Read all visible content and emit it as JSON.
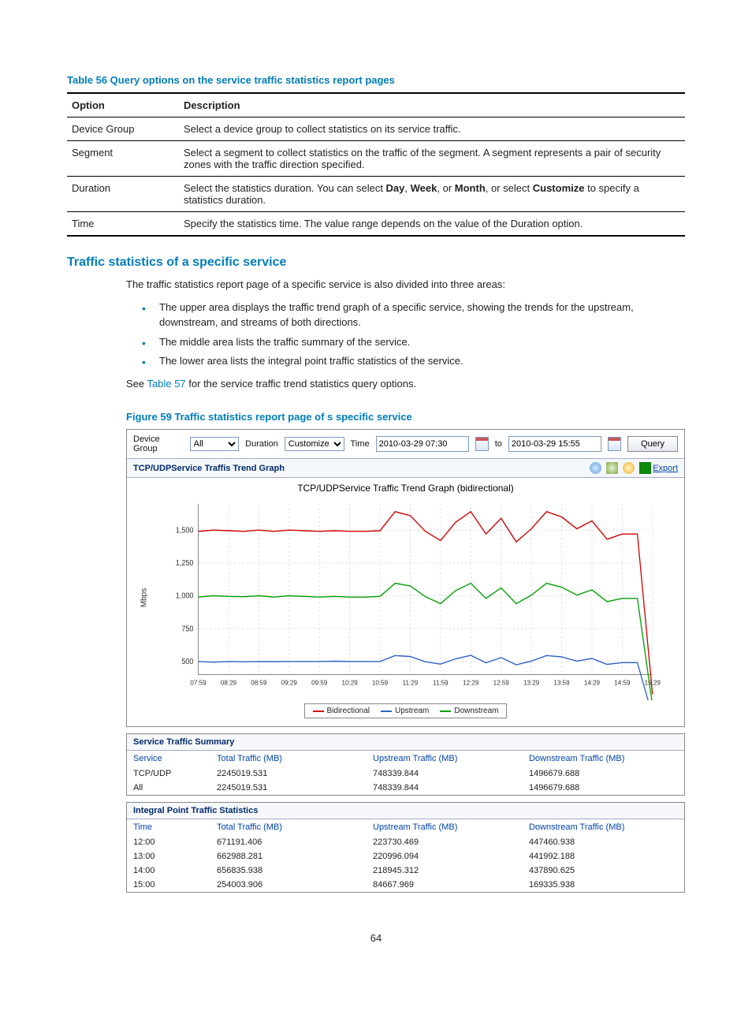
{
  "table56": {
    "title": "Table 56 Query options on the service traffic statistics report pages",
    "headers": {
      "option": "Option",
      "desc": "Description"
    },
    "rows": [
      {
        "option": "Device Group",
        "desc": "Select a device group to collect statistics on its service traffic."
      },
      {
        "option": "Segment",
        "desc": "Select a segment to collect statistics on the traffic of the segment. A segment represents a pair of security zones with the traffic direction specified."
      },
      {
        "option": "Duration",
        "desc_parts": [
          "Select the statistics duration. You can select ",
          "Day",
          ", ",
          "Week",
          ", or ",
          "Month",
          ", or select ",
          "Customize",
          " to specify a statistics duration."
        ]
      },
      {
        "option": "Time",
        "desc": "Specify the statistics time. The value range depends on the value of the Duration option."
      }
    ]
  },
  "section": {
    "heading": "Traffic statistics of a specific service",
    "intro": "The traffic statistics report page of a specific service is also divided into three areas:",
    "bullets": [
      "The upper area displays the traffic trend graph of a specific service, showing the trends for the upstream, downstream, and streams of both directions.",
      "The middle area lists the traffic summary of the service.",
      "The lower area lists the integral point traffic statistics of the service."
    ],
    "see_prefix": "See ",
    "see_link": "Table 57",
    "see_suffix": " for the service traffic trend statistics query options."
  },
  "figure": {
    "title": "Figure 59 Traffic statistics report page of s specific service",
    "filter": {
      "device_group_label": "Device Group",
      "device_group_value": "All",
      "duration_label": "Duration",
      "duration_value": "Customize",
      "time_label": "Time",
      "time_from": "2010-03-29 07:30",
      "time_to_label": "to",
      "time_to": "2010-03-29 15:55",
      "query_btn": "Query"
    },
    "graph": {
      "panel_title": "TCP/UDPService Traffis Trend Graph",
      "chart_title": "TCP/UDPService Traffic Trend Graph (bidirectional)",
      "ylabel": "Mbps",
      "export_label": "Export",
      "legend": {
        "bidir": "Bidirectional",
        "up": "Upstream",
        "down": "Downstream"
      }
    },
    "summary": {
      "title": "Service Traffic Summary",
      "headers": {
        "service": "Service",
        "total": "Total Traffic (MB)",
        "up": "Upstream Traffic (MB)",
        "down": "Downstream Traffic (MB)"
      },
      "rows": [
        {
          "service": "TCP/UDP",
          "total": "2245019.531",
          "up": "748339.844",
          "down": "1496679.688"
        },
        {
          "service": "All",
          "total": "2245019.531",
          "up": "748339.844",
          "down": "1496679.688"
        }
      ]
    },
    "integral": {
      "title": "Integral Point Traffic Statistics",
      "headers": {
        "time": "Time",
        "total": "Total Traffic (MB)",
        "up": "Upstream Traffic (MB)",
        "down": "Downstream Traffic (MB)"
      },
      "rows": [
        {
          "time": "12:00",
          "total": "671191.406",
          "up": "223730.469",
          "down": "447460.938"
        },
        {
          "time": "13:00",
          "total": "662988.281",
          "up": "220996.094",
          "down": "441992.188"
        },
        {
          "time": "14:00",
          "total": "656835.938",
          "up": "218945.312",
          "down": "437890.625"
        },
        {
          "time": "15:00",
          "total": "254003.906",
          "up": "84667.969",
          "down": "169335.938"
        }
      ]
    }
  },
  "chart_data": {
    "type": "line",
    "x_ticks": [
      "07:59",
      "08:29",
      "08:59",
      "09:29",
      "09:59",
      "10:29",
      "10:59",
      "11:29",
      "11:59",
      "12:29",
      "12:59",
      "13:29",
      "13:59",
      "14:29",
      "14:59",
      "15:29"
    ],
    "y_ticks": [
      500,
      750,
      1000,
      1250,
      1500
    ],
    "ylabel": "Mbps",
    "series": [
      {
        "name": "Bidirectional",
        "color": "#d00000",
        "values": [
          1490,
          1500,
          1495,
          1490,
          1500,
          1490,
          1500,
          1495,
          1490,
          1495,
          1490,
          1490,
          1495,
          1640,
          1610,
          1490,
          1420,
          1560,
          1640,
          1470,
          1590,
          1410,
          1510,
          1640,
          1600,
          1510,
          1570,
          1430,
          1470,
          1470,
          250
        ]
      },
      {
        "name": "Upstream",
        "color": "#2e62c9",
        "values": [
          500,
          495,
          500,
          498,
          500,
          499,
          500,
          500,
          500,
          502,
          500,
          500,
          500,
          545,
          538,
          498,
          480,
          520,
          547,
          490,
          530,
          475,
          503,
          545,
          535,
          503,
          523,
          478,
          491,
          491,
          86
        ]
      },
      {
        "name": "Downstream",
        "color": "#00a000",
        "values": [
          990,
          1000,
          995,
          993,
          1000,
          990,
          1000,
          995,
          990,
          995,
          990,
          990,
          995,
          1095,
          1075,
          993,
          940,
          1040,
          1095,
          980,
          1060,
          940,
          1005,
          1095,
          1065,
          1005,
          1045,
          955,
          980,
          980,
          168
        ]
      }
    ],
    "x_range": [
      0,
      30
    ],
    "y_range": [
      400,
      1700
    ]
  },
  "pageno": "64"
}
